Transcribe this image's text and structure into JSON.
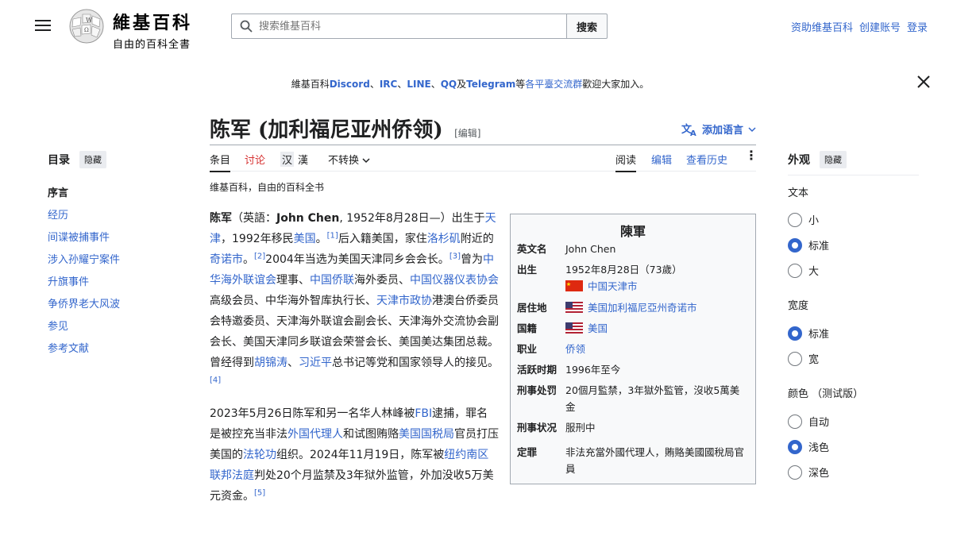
{
  "header": {
    "wordmark_title": "維基百科",
    "wordmark_tagline": "自由的百科全書",
    "search_placeholder": "搜索维基百科",
    "search_button": "搜索",
    "user_links": [
      "资助维基百科",
      "创建账号",
      "登录"
    ]
  },
  "banner": {
    "prefix": "維基百科",
    "discord": "Discord",
    "sep1": "、",
    "irc": "IRC",
    "sep2": "、",
    "line": "LINE",
    "sep3": "、",
    "qq": "QQ",
    "and": "及",
    "telegram": "Telegram",
    "deng": "等",
    "platform": "各平臺交流群",
    "suffix": "歡迎大家加入。"
  },
  "title": {
    "text": "陈军 (加利福尼亚州侨领)",
    "edit": "[编辑]",
    "add_language": "添加语言"
  },
  "tabs": {
    "article": "条目",
    "talk": "讨论",
    "variant1": "汉",
    "variant2": "漢",
    "no_convert": "不转换",
    "read": "阅读",
    "edit": "编辑",
    "history": "查看历史"
  },
  "toc": {
    "heading": "目录",
    "hide": "隐藏",
    "items": [
      "序言",
      "经历",
      "间谍被捕事件",
      "涉入孙耀宁案件",
      "升旗事件",
      "争侨界老大风波",
      "参见",
      "参考文献"
    ]
  },
  "article": {
    "tagline": "维基百科，自由的百科全书",
    "p1": [
      {
        "t": "陈军",
        "b": true
      },
      {
        "t": "（英語："
      },
      {
        "t": "John Chen",
        "b": true
      },
      {
        "t": ", 1952年8月28日—）出生于"
      },
      {
        "t": "天津",
        "l": true
      },
      {
        "t": "，1992年移民"
      },
      {
        "t": "美国",
        "l": true
      },
      {
        "t": "。"
      },
      {
        "t": "[1]",
        "s": true
      },
      {
        "t": "后入籍美国，家住"
      },
      {
        "t": "洛杉矶",
        "l": true
      },
      {
        "t": "附近的"
      },
      {
        "t": "奇诺市",
        "l": true
      },
      {
        "t": "。"
      },
      {
        "t": "[2]",
        "s": true
      },
      {
        "t": "2004年当选为美国天津同乡会会长。"
      },
      {
        "t": "[3]",
        "s": true
      },
      {
        "t": "曾为"
      },
      {
        "t": "中华海外联谊会",
        "l": true
      },
      {
        "t": "理事、"
      },
      {
        "t": "中国侨联",
        "l": true
      },
      {
        "t": "海外委员、"
      },
      {
        "t": "中国仪器仪表协会",
        "l": true
      },
      {
        "t": "高级会员、中华海外智库执行长、"
      },
      {
        "t": "天津市政协",
        "l": true
      },
      {
        "t": "港澳台侨委员会特邀委员、天津海外联谊会副会长、天津海外交流协会副会长、美国天津同乡联谊会荣誉会长、美国美达集团总裁。曾经得到"
      },
      {
        "t": "胡锦涛",
        "l": true
      },
      {
        "t": "、"
      },
      {
        "t": "习近平",
        "l": true
      },
      {
        "t": "总书记等党和国家领导人的接见。"
      },
      {
        "t": "[4]",
        "s": true
      }
    ],
    "p2": [
      {
        "t": "2023年5月26日陈军和另一名华人林峰被"
      },
      {
        "t": "FBI",
        "l": true
      },
      {
        "t": "逮捕，罪名是被控充当非法"
      },
      {
        "t": "外国代理人",
        "l": true
      },
      {
        "t": "和试图贿赂"
      },
      {
        "t": "美国国税局",
        "l": true
      },
      {
        "t": "官员打压美国的"
      },
      {
        "t": "法轮功",
        "l": true
      },
      {
        "t": "组织。2024年11月19日，陈军被"
      },
      {
        "t": "纽约南区联邦法庭",
        "l": true
      },
      {
        "t": "判处20个月监禁及3年狱外监管，外加没收5万美元资金。"
      },
      {
        "t": "[5]",
        "s": true
      }
    ]
  },
  "infobox": {
    "title": "陳軍",
    "rows": [
      {
        "label": "英文名",
        "value": "John Chen"
      },
      {
        "label": "出生",
        "value": "1952年8月28日（73歲）",
        "value2": "中国天津市"
      },
      {
        "label": "居住地",
        "value": "美国加利福尼亞州奇诺市"
      },
      {
        "label": "国籍",
        "value": "美国"
      },
      {
        "label": "职业",
        "value": "侨领"
      },
      {
        "label": "活跃时期",
        "value": "1996年至今"
      },
      {
        "label": "刑事处罚",
        "value": "20個月監禁，3年獄外監管，沒收5萬美金"
      },
      {
        "label": "刑事状况",
        "value": "服刑中"
      },
      {
        "label": "定罪",
        "value": "非法充當外國代理人，賄賂美國國稅局官員"
      }
    ]
  },
  "appearance": {
    "heading": "外观",
    "hide": "隐藏",
    "text_label": "文本",
    "text_options": [
      "小",
      "标准",
      "大"
    ],
    "text_selected": 1,
    "width_label": "宽度",
    "width_options": [
      "标准",
      "宽"
    ],
    "width_selected": 0,
    "color_label": "颜色 （测试版）",
    "color_options": [
      "自动",
      "浅色",
      "深色"
    ],
    "color_selected": 1
  },
  "colors": {
    "link": "#3366cc",
    "accent": "#3366cc",
    "infobox_bg": "#f8f9fa"
  }
}
